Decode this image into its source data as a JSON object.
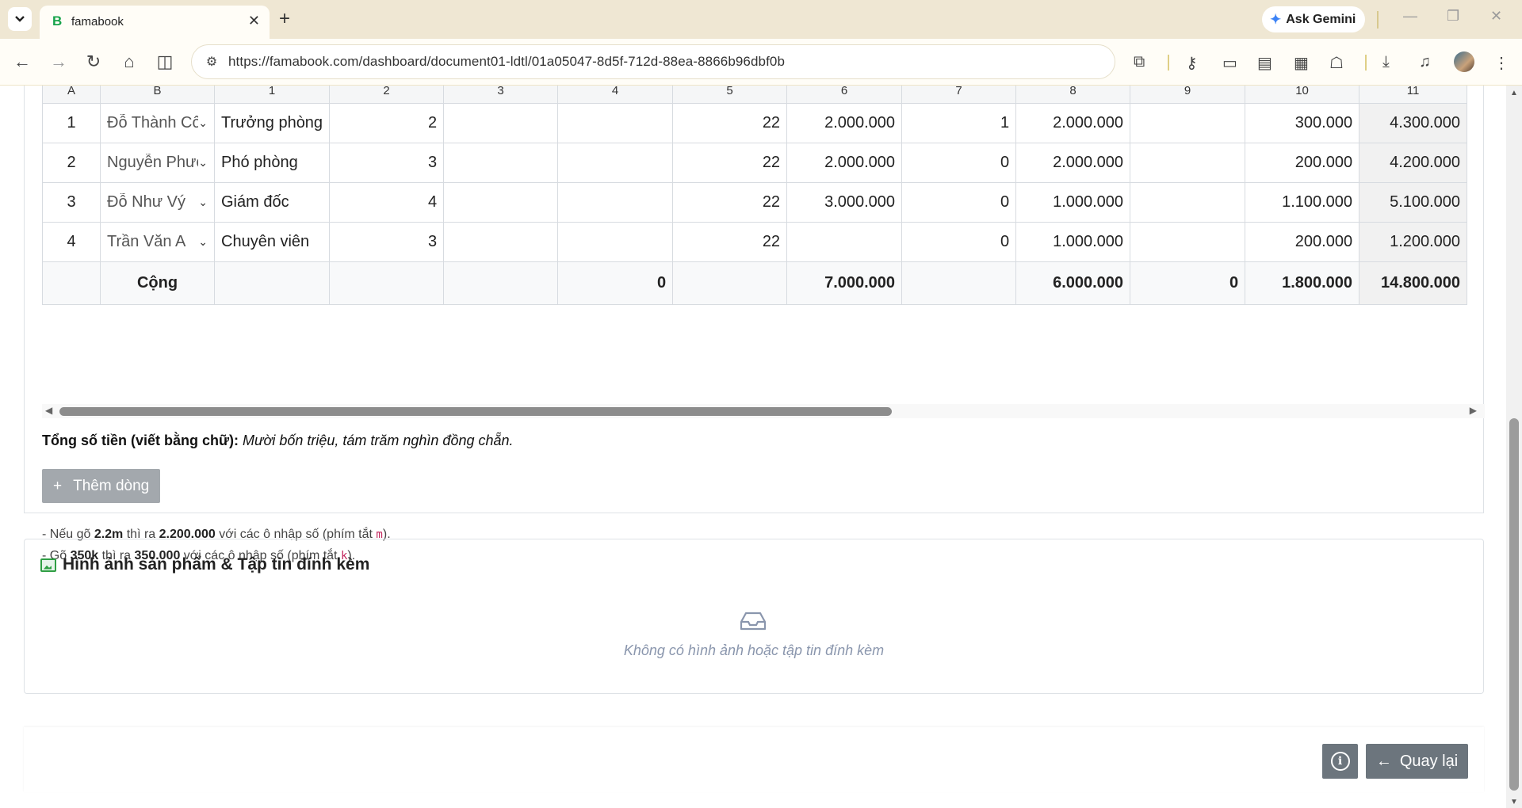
{
  "browser": {
    "tab_title": "famabook",
    "tab_favicon": "B",
    "url": "https://famabook.com/dashboard/document01-ldtl/01a05047-8d5f-712d-88ea-8866b96dbf0b",
    "ask_gemini": "Ask Gemini"
  },
  "table": {
    "headers": [
      "A",
      "B",
      "1",
      "2",
      "3",
      "4",
      "5",
      "6",
      "7",
      "8",
      "9",
      "10",
      "11"
    ],
    "rows": [
      {
        "a": "1",
        "b": "Đỗ Thành Công",
        "c1": "Trưởng phòng",
        "c2": "2",
        "c3": "",
        "c4": "",
        "c5": "22",
        "c6": "2.000.000",
        "c7": "1",
        "c8": "2.000.000",
        "c9": "",
        "c10": "300.000",
        "c11": "4.300.000"
      },
      {
        "a": "2",
        "b": "Nguyễn Phương",
        "c1": "Phó phòng",
        "c2": "3",
        "c3": "",
        "c4": "",
        "c5": "22",
        "c6": "2.000.000",
        "c7": "0",
        "c8": "2.000.000",
        "c9": "",
        "c10": "200.000",
        "c11": "4.200.000"
      },
      {
        "a": "3",
        "b": "Đỗ Như Vý",
        "c1": "Giám đốc",
        "c2": "4",
        "c3": "",
        "c4": "",
        "c5": "22",
        "c6": "3.000.000",
        "c7": "0",
        "c8": "1.000.000",
        "c9": "",
        "c10": "1.100.000",
        "c11": "5.100.000"
      },
      {
        "a": "4",
        "b": "Trần Văn A",
        "c1": "Chuyên viên",
        "c2": "3",
        "c3": "",
        "c4": "",
        "c5": "22",
        "c6": "",
        "c7": "0",
        "c8": "1.000.000",
        "c9": "",
        "c10": "200.000",
        "c11": "1.200.000"
      }
    ],
    "total": {
      "label": "Cộng",
      "c4": "0",
      "c6": "7.000.000",
      "c8": "6.000.000",
      "c9": "0",
      "c10": "1.800.000",
      "c11": "14.800.000"
    }
  },
  "amount_words": {
    "label": "Tổng số tiền (viết bằng chữ):",
    "value": "Mười bốn triệu, tám trăm nghìn đồng chẵn."
  },
  "add_row": {
    "icon": "+",
    "label": "Thêm dòng"
  },
  "hints": [
    {
      "p1": "- Nếu gõ ",
      "b1": "2.2m",
      "p2": " thì ra ",
      "b2": "2.200.000",
      "p3": " với các ô nhập số (phím tắt ",
      "key": "m",
      "p4": ")."
    },
    {
      "p1": "- Gõ ",
      "b1": "350k",
      "p2": " thì ra ",
      "b2": "350.000",
      "p3": " với các ô nhập số (phím tắt ",
      "key": "k",
      "p4": ")."
    }
  ],
  "attachments": {
    "title": "Hình ảnh sản phẩm & Tập tin đính kèm",
    "empty": "Không có hình ảnh hoặc tập tin đính kèm"
  },
  "footer": {
    "info_icon": "i",
    "back_arrow": "←",
    "back_label": "Quay lại"
  }
}
